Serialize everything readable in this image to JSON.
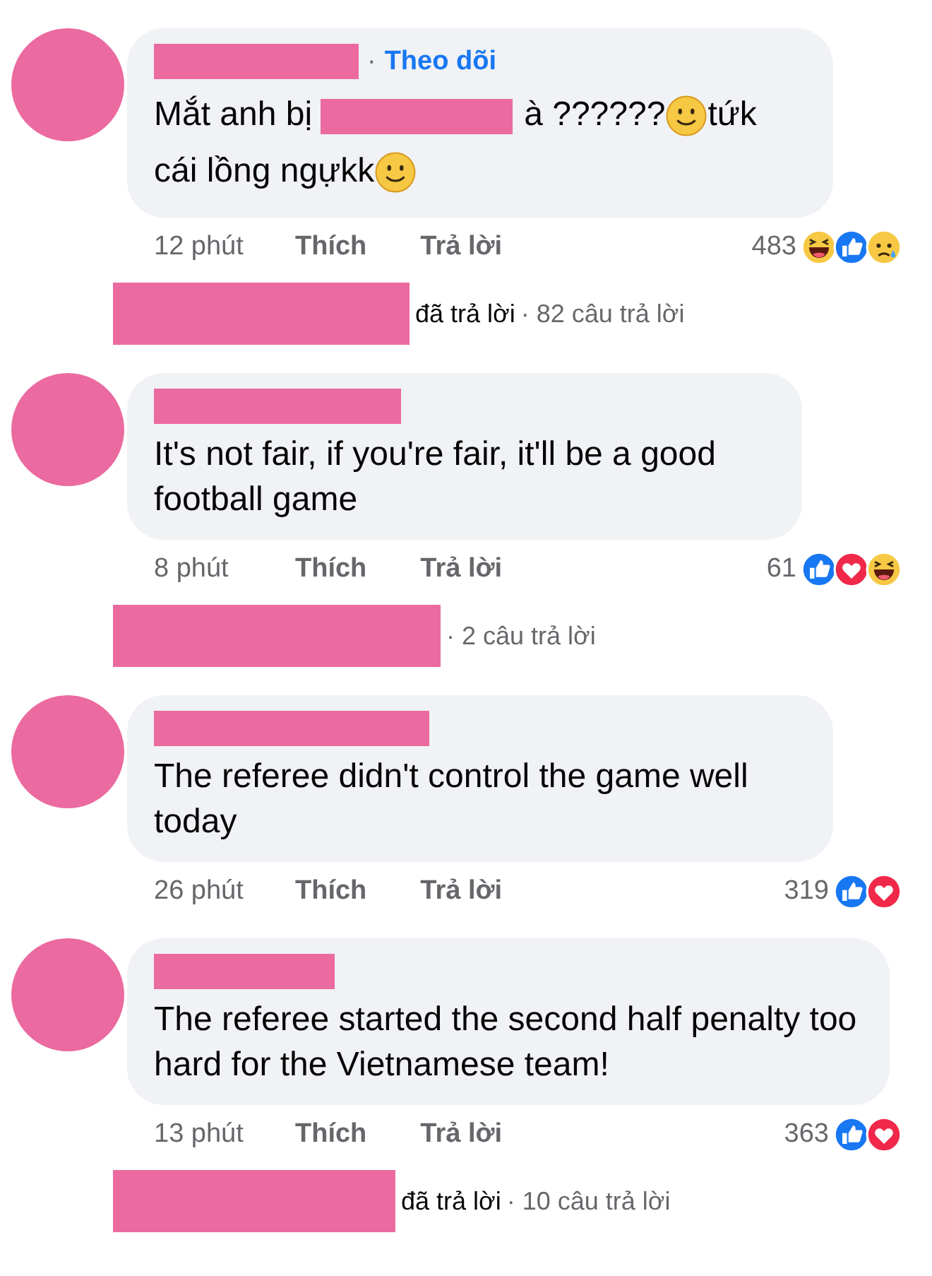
{
  "comments": [
    {
      "separator": "·",
      "follow": "Theo dõi",
      "body": [
        {
          "kind": "text",
          "text": "Mắt anh bị"
        },
        {
          "kind": "redaction"
        },
        {
          "kind": "text",
          "text": "à ??????"
        },
        {
          "kind": "emoji"
        },
        {
          "kind": "text",
          "text": "tứk cái lồng ngựkk"
        },
        {
          "kind": "emoji"
        }
      ],
      "time": "12 phút",
      "like": "Thích",
      "reply": "Trả lời",
      "count": "483",
      "reactions": [
        {
          "kind": "haha"
        },
        {
          "kind": "like"
        },
        {
          "kind": "sad"
        }
      ],
      "replies": {
        "replied": "đã trả lời",
        "count": "· 82 câu trả lời"
      }
    },
    {
      "body": [
        {
          "kind": "text",
          "text": "It's not fair, if you're fair, it'll be a good football game"
        }
      ],
      "time": "8 phút",
      "like": "Thích",
      "reply": "Trả lời",
      "count": "61",
      "reactions": [
        {
          "kind": "like"
        },
        {
          "kind": "love"
        },
        {
          "kind": "haha"
        }
      ],
      "replies": {
        "count": "· 2 câu trả lời"
      }
    },
    {
      "body": [
        {
          "kind": "text",
          "text": "The referee didn't control the game well today"
        }
      ],
      "time": "26 phút",
      "like": "Thích",
      "reply": "Trả lời",
      "count": "319",
      "reactions": [
        {
          "kind": "like"
        },
        {
          "kind": "love"
        }
      ]
    },
    {
      "body": [
        {
          "kind": "text",
          "text": "The referee started the second half penalty too hard for the Vietnamese team!"
        }
      ],
      "time": "13 phút",
      "like": "Thích",
      "reply": "Trả lời",
      "count": "363",
      "reactions": [
        {
          "kind": "like"
        },
        {
          "kind": "love"
        }
      ],
      "replies": {
        "replied": "đã trả lời",
        "count": "· 10 câu trả lời"
      }
    }
  ]
}
